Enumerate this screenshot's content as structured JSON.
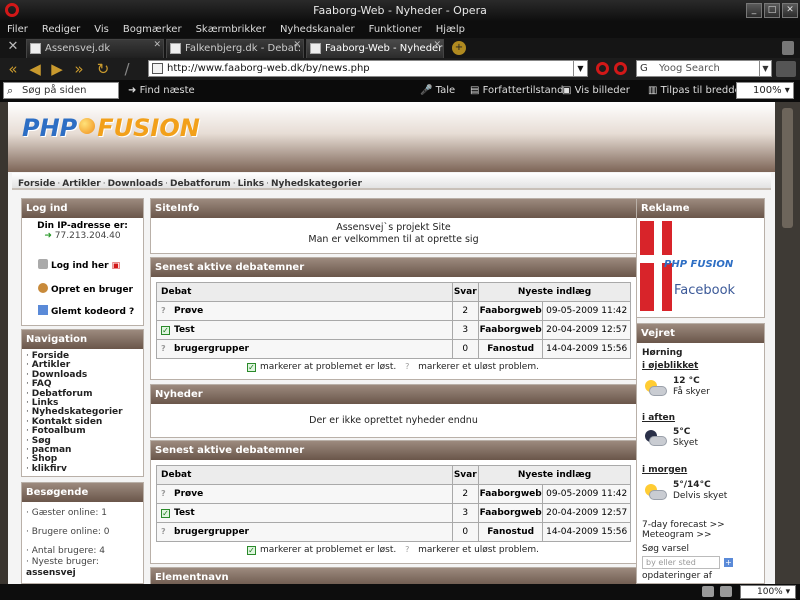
{
  "window": {
    "title": "Faaborg-Web - Nyheder - Opera"
  },
  "menu": [
    "Filer",
    "Rediger",
    "Vis",
    "Bogmærker",
    "Skærmbrikker",
    "Nyhedskanaler",
    "Funktioner",
    "Hjælp"
  ],
  "tabs": [
    {
      "label": "Assensvej.dk"
    },
    {
      "label": "Falkenbjerg.dk - Debat: ..."
    },
    {
      "label": "Faaborg-Web - Nyheder"
    }
  ],
  "address": {
    "url": "http://www.faaborg-web.dk/by/news.php",
    "search_placeholder": "Yoog Search"
  },
  "toolbar": {
    "find_placeholder": "Søg på siden",
    "find_next": "Find næste",
    "speech": "Tale",
    "author_mode": "Forfattertilstand",
    "show_images": "Vis billeder",
    "fit_width": "Tilpas til bredden",
    "zoom": "100%"
  },
  "site": {
    "logo_left": "PHP",
    "logo_right": "FUSION",
    "nav": [
      "Forside",
      "Artikler",
      "Downloads",
      "Debatforum",
      "Links",
      "Nyhedskategorier"
    ]
  },
  "login": {
    "caption": "Log ind",
    "ip_label": "Din IP-adresse er:",
    "ip": "77.213.204.40",
    "login_link": "Log ind her",
    "register_link": "Opret en bruger",
    "forgot_link": "Glemt kodeord ?"
  },
  "navigation": {
    "caption": "Navigation",
    "items": [
      "Forside",
      "Artikler",
      "Downloads",
      "FAQ",
      "Debatforum",
      "Links",
      "Nyhedskategorier",
      "Kontakt siden",
      "Fotoalbum",
      "Søg",
      "pacman",
      "Shop",
      "klikfirv"
    ]
  },
  "visitors": {
    "caption": "Besøgende",
    "guests": "Gæster online: 1",
    "users": "Brugere online: 0",
    "count": "Antal brugere: 4",
    "newest_label": "Nyeste bruger:",
    "newest": "assensvej"
  },
  "siteinfo": {
    "caption": "SiteInfo",
    "line1": "Assensvej`s projekt Site",
    "line2": "Man er velkommen til at oprette sig"
  },
  "debates": {
    "caption": "Senest aktive debatemner",
    "headers": [
      "Debat",
      "Svar",
      "Nyeste indlæg"
    ],
    "rows": [
      {
        "title": "Prøve",
        "solved": false,
        "replies": "2",
        "author": "Faaborgweb",
        "date": "09-05-2009 11:42"
      },
      {
        "title": "Test",
        "solved": true,
        "replies": "3",
        "author": "Faaborgweb",
        "date": "20-04-2009 12:57"
      },
      {
        "title": "brugergrupper",
        "solved": false,
        "replies": "0",
        "author": "Fanostud",
        "date": "14-04-2009 15:56"
      }
    ],
    "legend_solved": "markerer at problemet er løst.",
    "legend_unsolved": "markerer et uløst problem."
  },
  "news": {
    "caption": "Nyheder",
    "empty": "Der er ikke oprettet nyheder endnu"
  },
  "elementnavn": {
    "caption": "Elementnavn"
  },
  "ad": {
    "caption": "Reklame",
    "fb_logo": "PHP FUSION",
    "fb_label": "Facebook"
  },
  "weather": {
    "caption": "Vejret",
    "city": "Hørning",
    "now_label": "i øjeblikket",
    "now_temp": "12 °C",
    "now_desc": "Få skyer",
    "evening_label": "i aften",
    "evening_temp": "5°C",
    "evening_desc": "Skyet",
    "tomorrow_label": "i morgen",
    "tomorrow_temp": "5°/14°C",
    "tomorrow_desc": "Delvis skyet",
    "forecast": "7-day forecast >>",
    "meteogram": "Meteogram >>",
    "search_label": "Søg varsel",
    "search_placeholder": "by eller sted",
    "updates": "opdateringer af"
  },
  "status": {
    "zoom": "100%"
  }
}
